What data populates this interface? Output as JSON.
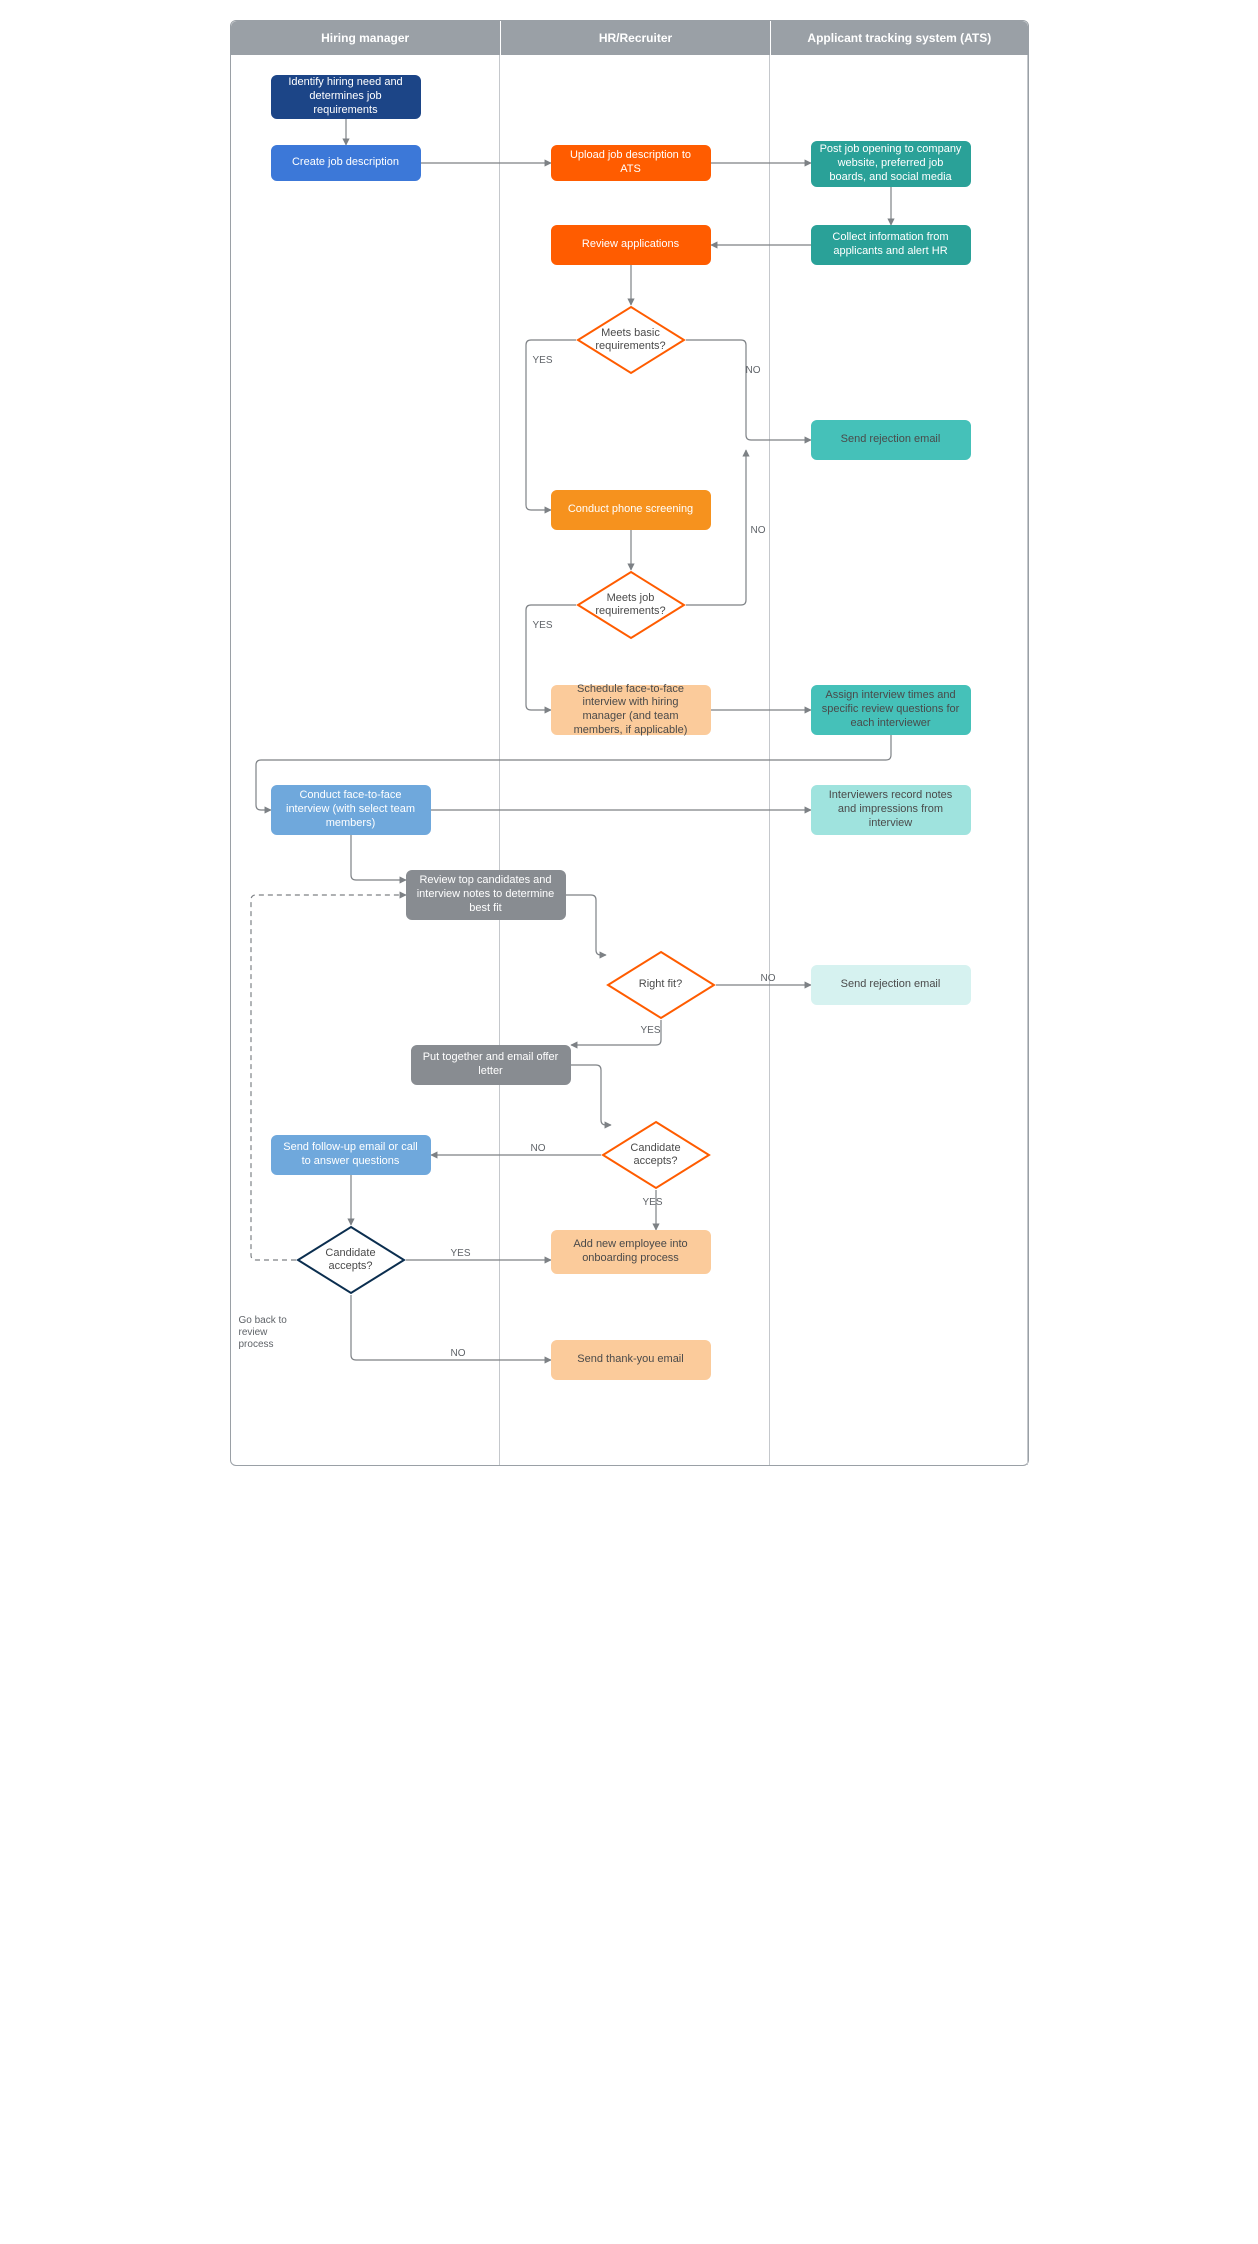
{
  "headers": {
    "c1": "Hiring manager",
    "c2": "HR/Recruiter",
    "c3": "Applicant tracking system (ATS)"
  },
  "nodes": {
    "n1": "Identify hiring need and determines job requirements",
    "n2": "Create job description",
    "n3": "Upload job description to ATS",
    "n4": "Post job opening to company website, preferred job boards, and social media",
    "n5": "Collect information from applicants and alert HR",
    "n6": "Review applications",
    "d1": "Meets basic requirements?",
    "n7": "Send rejection email",
    "n8": "Conduct phone screening",
    "d2": "Meets job requirements?",
    "n9": "Schedule face-to-face interview with hiring manager (and team members, if applicable)",
    "n10": "Assign interview times and specific review questions for each interviewer",
    "n11": "Conduct face-to-face interview (with select team members)",
    "n12": "Interviewers record notes and impressions from interview",
    "n13": "Review top candidates and interview notes to determine best fit",
    "d3": "Right fit?",
    "n14": "Send rejection email",
    "n15": "Put together and email offer letter",
    "d4": "Candidate accepts?",
    "n16": "Send follow-up email or call to answer questions",
    "d5": "Candidate accepts?",
    "n17": "Add new employee into onboarding process",
    "n18": "Send thank-you email"
  },
  "labels": {
    "yes": "YES",
    "no": "NO",
    "goback": "Go back to review process"
  }
}
